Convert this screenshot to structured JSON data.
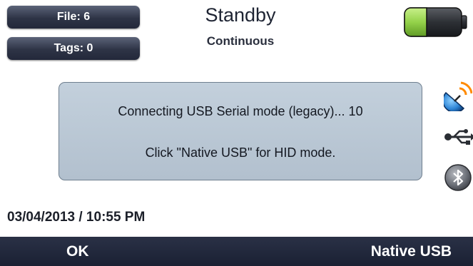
{
  "header": {
    "file_label": "File: 6",
    "tags_label": "Tags: 0",
    "status_title": "Standby",
    "status_subtitle": "Continuous",
    "battery_icon": "battery-icon"
  },
  "dialog": {
    "line1": "Connecting USB Serial mode (legacy)... 10",
    "line2": "Click \"Native USB\" for HID mode."
  },
  "side_icons": [
    "satellite-icon",
    "usb-icon",
    "bluetooth-icon"
  ],
  "datetime": "03/04/2013  /  10:55 PM",
  "softkeys": {
    "left": "OK",
    "right": "Native USB"
  },
  "colors": {
    "bar": "#1e2436",
    "dialog_bg": "#b9c6d3",
    "battery_green": "#9ad651"
  }
}
